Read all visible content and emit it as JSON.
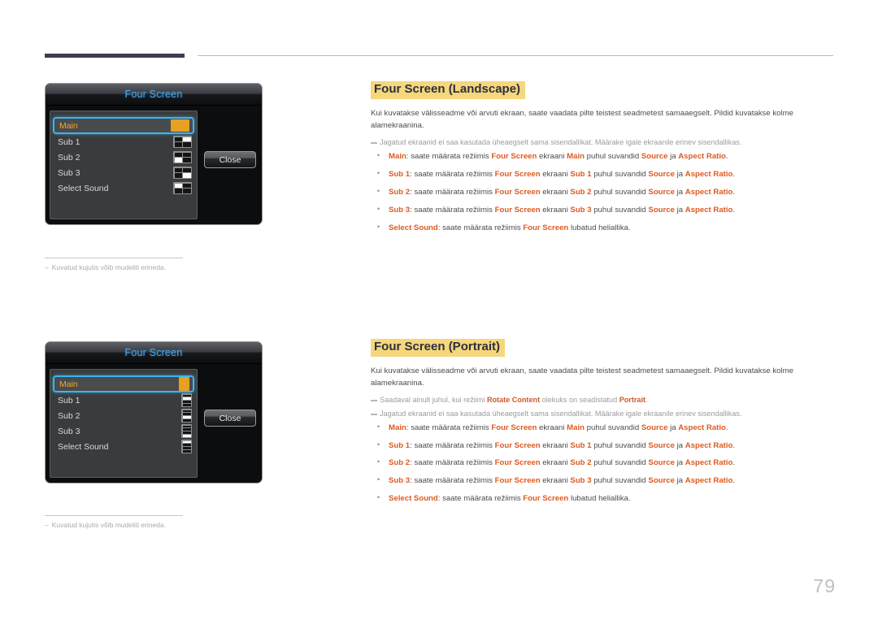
{
  "page": {
    "number": "79",
    "header_divider": true
  },
  "figures": [
    {
      "id": "landscape-osd",
      "title": "Four Screen",
      "close_label": "Close",
      "rows": [
        {
          "label": "Main",
          "selected": true,
          "icon": "quad-all-highlight",
          "quad": [
            1,
            1,
            1,
            1
          ]
        },
        {
          "label": "Sub 1",
          "selected": false,
          "icon": "quad-top-right-highlight",
          "quad": [
            0,
            1,
            0,
            0
          ]
        },
        {
          "label": "Sub 2",
          "selected": false,
          "icon": "quad-bottom-left-highlight",
          "quad": [
            0,
            0,
            1,
            0
          ]
        },
        {
          "label": "Sub 3",
          "selected": false,
          "icon": "quad-bottom-right-highlight",
          "quad": [
            0,
            0,
            0,
            1
          ]
        },
        {
          "label": "Select Sound",
          "selected": false,
          "icon": "quad-top-left-highlight",
          "quad": [
            1,
            0,
            0,
            0
          ]
        }
      ],
      "note": "Kuvatud kujutis võib mudeliti erineda.",
      "note_dash": "‒"
    },
    {
      "id": "portrait-osd",
      "title": "Four Screen",
      "close_label": "Close",
      "rows": [
        {
          "label": "Main",
          "selected": true,
          "icon": "strip-all-highlight",
          "strip": [
            1,
            1,
            1,
            1
          ]
        },
        {
          "label": "Sub 1",
          "selected": false,
          "icon": "strip-bar2-highlight",
          "strip": [
            0,
            1,
            0,
            0
          ]
        },
        {
          "label": "Sub 2",
          "selected": false,
          "icon": "strip-bar3-highlight",
          "strip": [
            0,
            0,
            1,
            0
          ]
        },
        {
          "label": "Sub 3",
          "selected": false,
          "icon": "strip-bar4-highlight",
          "strip": [
            0,
            0,
            0,
            1
          ]
        },
        {
          "label": "Select Sound",
          "selected": false,
          "icon": "strip-bar1-highlight",
          "strip": [
            1,
            0,
            0,
            0
          ]
        }
      ],
      "note": "Kuvatud kujutis võib mudeliti erineda.",
      "note_dash": "‒"
    }
  ],
  "sections": [
    {
      "title": "Four Screen (Landscape)",
      "intro": "Kui kuvatakse välisseadme või arvuti ekraan, saate vaadata pilte teistest seadmetest samaaegselt. Pildid kuvatakse kolme alamekraanina.",
      "notes": [
        {
          "parts": [
            {
              "t": "Jagatud ekraanid ei saa kasutada üheaegselt sama sisendallikat. Määrake igale ekraanile erinev sisendallikas.",
              "b": false
            }
          ]
        }
      ],
      "bullets": [
        {
          "parts": [
            {
              "t": "Main",
              "b": true
            },
            {
              "t": ": saate määrata režiimis ",
              "b": false
            },
            {
              "t": "Four Screen",
              "b": true
            },
            {
              "t": " ekraani ",
              "b": false
            },
            {
              "t": "Main",
              "b": true
            },
            {
              "t": " puhul suvandid ",
              "b": false
            },
            {
              "t": "Source",
              "b": true
            },
            {
              "t": " ja ",
              "b": false
            },
            {
              "t": "Aspect Ratio",
              "b": true
            },
            {
              "t": ".",
              "b": false
            }
          ]
        },
        {
          "parts": [
            {
              "t": "Sub 1",
              "b": true
            },
            {
              "t": ": saate määrata režiimis ",
              "b": false
            },
            {
              "t": "Four Screen",
              "b": true
            },
            {
              "t": " ekraani ",
              "b": false
            },
            {
              "t": "Sub 1",
              "b": true
            },
            {
              "t": " puhul suvandid ",
              "b": false
            },
            {
              "t": "Source",
              "b": true
            },
            {
              "t": " ja ",
              "b": false
            },
            {
              "t": "Aspect Ratio",
              "b": true
            },
            {
              "t": ".",
              "b": false
            }
          ]
        },
        {
          "parts": [
            {
              "t": "Sub 2",
              "b": true
            },
            {
              "t": ": saate määrata režiimis ",
              "b": false
            },
            {
              "t": "Four Screen",
              "b": true
            },
            {
              "t": " ekraani ",
              "b": false
            },
            {
              "t": "Sub 2",
              "b": true
            },
            {
              "t": " puhul suvandid ",
              "b": false
            },
            {
              "t": "Source",
              "b": true
            },
            {
              "t": " ja ",
              "b": false
            },
            {
              "t": "Aspect Ratio",
              "b": true
            },
            {
              "t": ".",
              "b": false
            }
          ]
        },
        {
          "parts": [
            {
              "t": "Sub 3",
              "b": true
            },
            {
              "t": ": saate määrata režiimis ",
              "b": false
            },
            {
              "t": "Four Screen",
              "b": true
            },
            {
              "t": " ekraani ",
              "b": false
            },
            {
              "t": "Sub 3",
              "b": true
            },
            {
              "t": " puhul suvandid ",
              "b": false
            },
            {
              "t": "Source",
              "b": true
            },
            {
              "t": " ja ",
              "b": false
            },
            {
              "t": "Aspect Ratio",
              "b": true
            },
            {
              "t": ".",
              "b": false
            }
          ]
        },
        {
          "parts": [
            {
              "t": "Select Sound",
              "b": true
            },
            {
              "t": ": saate määrata režiimis ",
              "b": false
            },
            {
              "t": "Four Screen",
              "b": true
            },
            {
              "t": " lubatud heliallika.",
              "b": false
            }
          ]
        }
      ]
    },
    {
      "title": "Four Screen (Portrait)",
      "intro": "Kui kuvatakse välisseadme või arvuti ekraan, saate vaadata pilte teistest seadmetest samaaegselt. Pildid kuvatakse kolme alamekraanina.",
      "notes": [
        {
          "parts": [
            {
              "t": "Saadaval ainult juhul, kui režiimi ",
              "b": false
            },
            {
              "t": "Rotate Content",
              "b": true
            },
            {
              "t": " olekuks on seadistatud ",
              "b": false
            },
            {
              "t": "Portrait",
              "b": true
            },
            {
              "t": ".",
              "b": false
            }
          ]
        },
        {
          "parts": [
            {
              "t": "Jagatud ekraanid ei saa kasutada üheaegselt sama sisendallikat. Määrake igale ekraanile erinev sisendallikas.",
              "b": false
            }
          ]
        }
      ],
      "bullets": [
        {
          "parts": [
            {
              "t": "Main",
              "b": true
            },
            {
              "t": ": saate määrata režiimis ",
              "b": false
            },
            {
              "t": "Four Screen",
              "b": true
            },
            {
              "t": " ekraani ",
              "b": false
            },
            {
              "t": "Main",
              "b": true
            },
            {
              "t": " puhul suvandid ",
              "b": false
            },
            {
              "t": "Source",
              "b": true
            },
            {
              "t": " ja ",
              "b": false
            },
            {
              "t": "Aspect Ratio",
              "b": true
            },
            {
              "t": ".",
              "b": false
            }
          ]
        },
        {
          "parts": [
            {
              "t": "Sub 1",
              "b": true
            },
            {
              "t": ": saate määrata režiimis ",
              "b": false
            },
            {
              "t": "Four Screen",
              "b": true
            },
            {
              "t": " ekraani ",
              "b": false
            },
            {
              "t": "Sub 1",
              "b": true
            },
            {
              "t": " puhul suvandid ",
              "b": false
            },
            {
              "t": "Source",
              "b": true
            },
            {
              "t": " ja ",
              "b": false
            },
            {
              "t": "Aspect Ratio",
              "b": true
            },
            {
              "t": ".",
              "b": false
            }
          ]
        },
        {
          "parts": [
            {
              "t": "Sub 2",
              "b": true
            },
            {
              "t": ": saate määrata režiimis ",
              "b": false
            },
            {
              "t": "Four Screen",
              "b": true
            },
            {
              "t": " ekraani ",
              "b": false
            },
            {
              "t": "Sub 2",
              "b": true
            },
            {
              "t": " puhul suvandid ",
              "b": false
            },
            {
              "t": "Source",
              "b": true
            },
            {
              "t": " ja ",
              "b": false
            },
            {
              "t": "Aspect Ratio",
              "b": true
            },
            {
              "t": ".",
              "b": false
            }
          ]
        },
        {
          "parts": [
            {
              "t": "Sub 3",
              "b": true
            },
            {
              "t": ": saate määrata režiimis ",
              "b": false
            },
            {
              "t": "Four Screen",
              "b": true
            },
            {
              "t": " ekraani ",
              "b": false
            },
            {
              "t": "Sub 3",
              "b": true
            },
            {
              "t": " puhul suvandid ",
              "b": false
            },
            {
              "t": "Source",
              "b": true
            },
            {
              "t": " ja ",
              "b": false
            },
            {
              "t": "Aspect Ratio",
              "b": true
            },
            {
              "t": ".",
              "b": false
            }
          ]
        },
        {
          "parts": [
            {
              "t": "Select Sound",
              "b": true
            },
            {
              "t": ": saate määrata režiimis ",
              "b": false
            },
            {
              "t": "Four Screen",
              "b": true
            },
            {
              "t": " lubatud heliallika.",
              "b": false
            }
          ]
        }
      ]
    }
  ],
  "colors": {
    "title_highlight": "#f5d77c",
    "accent_orange": "#dd5a21",
    "osd_selected_border": "#39b5f0",
    "osd_title_blue": "#4ea7e8",
    "osd_main_amber": "#e8a020",
    "header_bar": "#3c3c52"
  }
}
